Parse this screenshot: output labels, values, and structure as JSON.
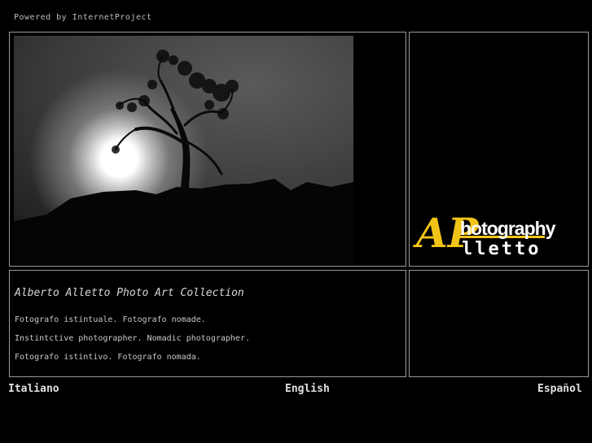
{
  "header": {
    "powered_by": "Powered by InternetProject"
  },
  "logo": {
    "ap": "AP",
    "hotography": "hotography",
    "lletto": "lletto"
  },
  "intro": {
    "title": "Alberto Alletto Photo Art Collection",
    "lines": [
      "Fotografo istintuale. Fotografo nomade.",
      "Instintctive photographer. Nomadic photographer.",
      "Fotografo istintivo. Fotografo nomada."
    ]
  },
  "languages": [
    {
      "label": "Italiano"
    },
    {
      "label": "English"
    },
    {
      "label": "Español"
    }
  ]
}
